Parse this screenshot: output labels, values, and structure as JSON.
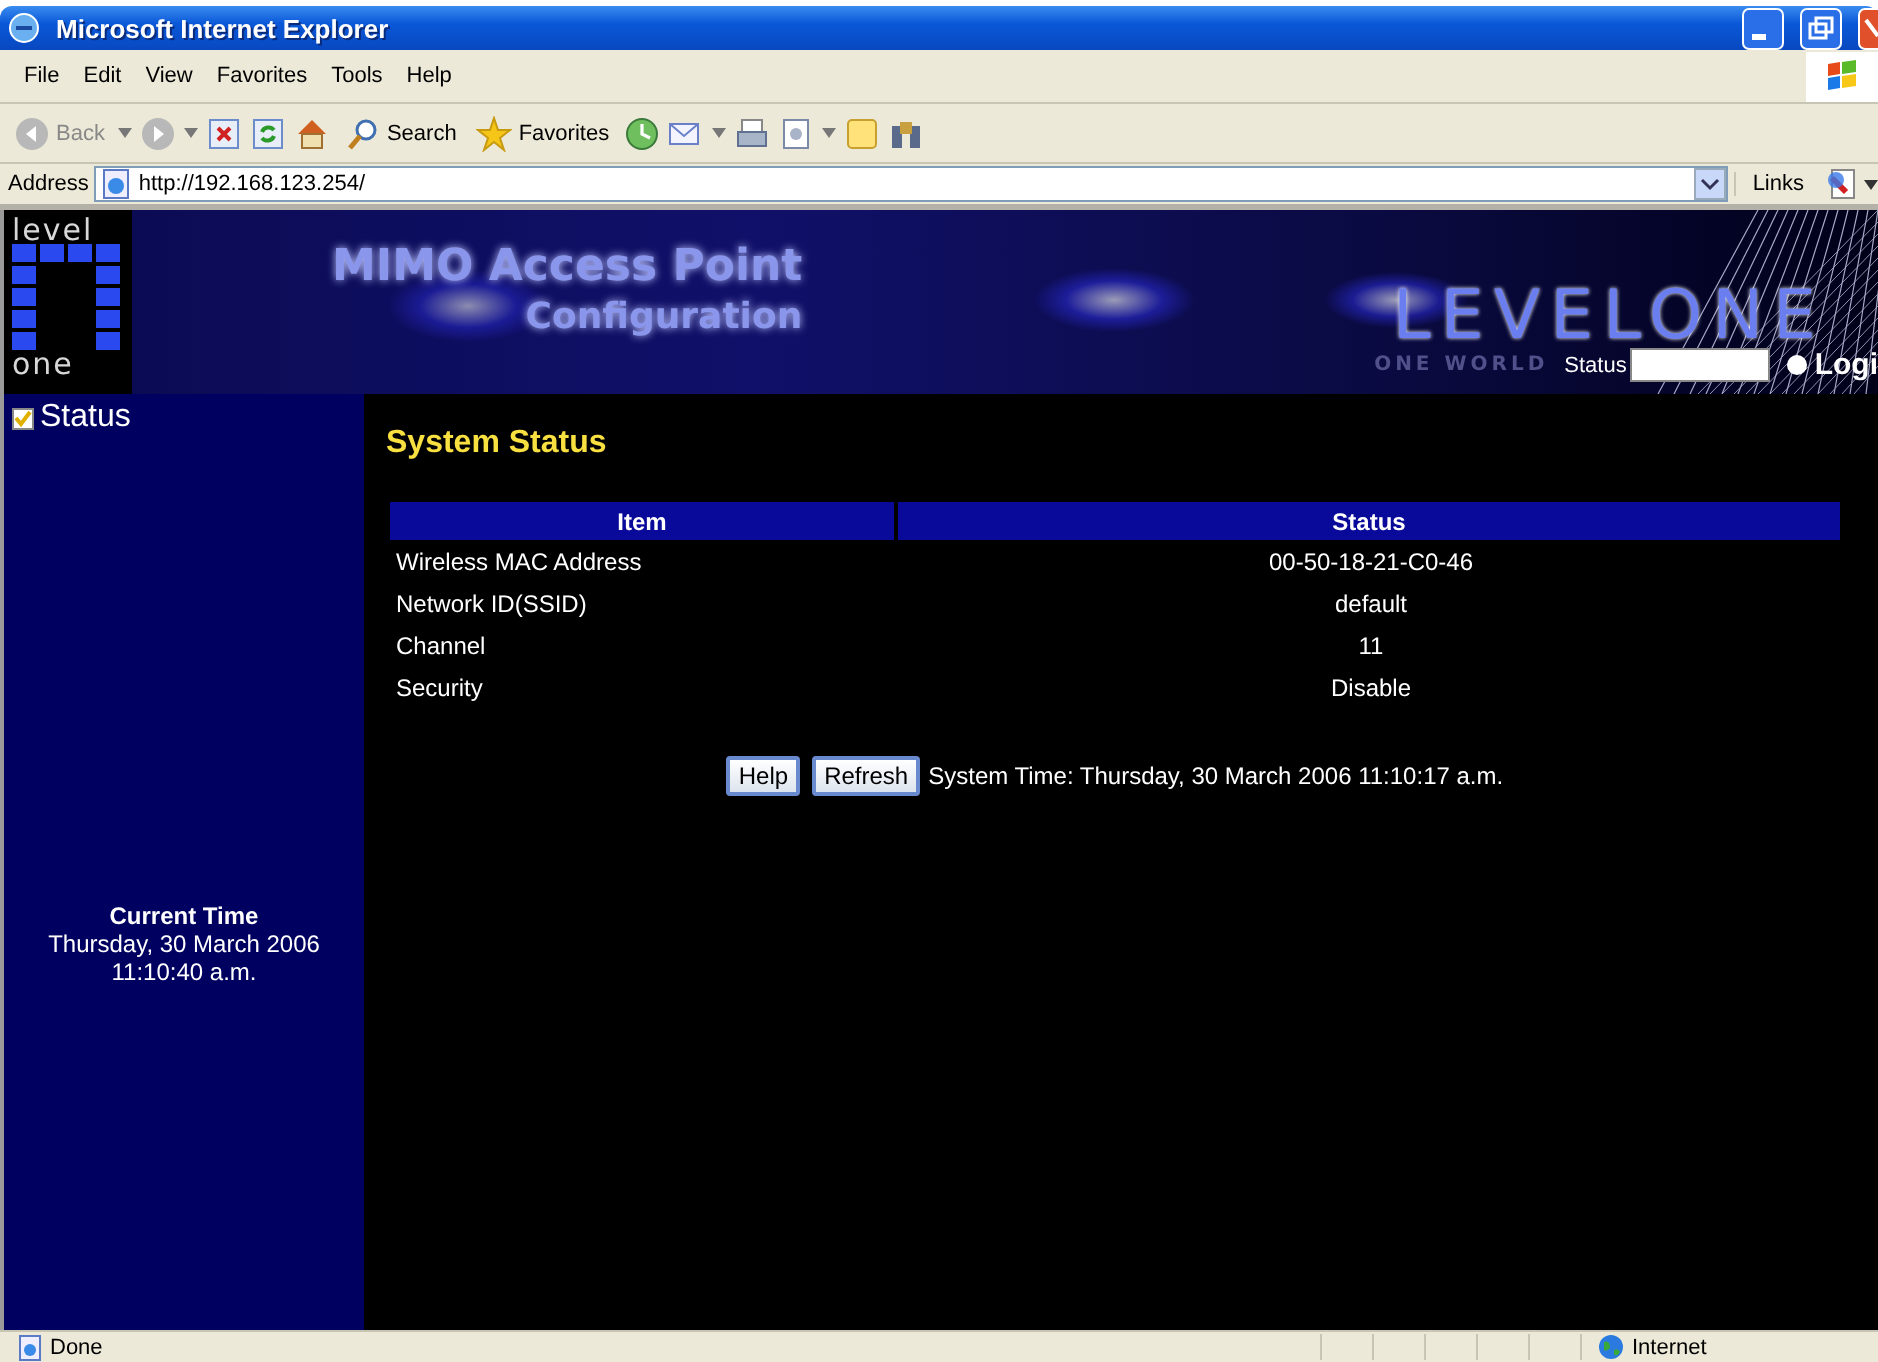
{
  "window": {
    "title": "Microsoft Internet Explorer"
  },
  "menu": [
    "File",
    "Edit",
    "View",
    "Favorites",
    "Tools",
    "Help"
  ],
  "toolbar": [
    {
      "kind": "back",
      "label": "Back"
    },
    {
      "kind": "forward"
    },
    {
      "kind": "stop"
    },
    {
      "kind": "refresh"
    },
    {
      "kind": "home"
    },
    {
      "kind": "search",
      "label": "Search"
    },
    {
      "kind": "favorites",
      "label": "Favorites"
    },
    {
      "kind": "history"
    },
    {
      "kind": "mail"
    },
    {
      "kind": "print"
    },
    {
      "kind": "edit"
    },
    {
      "kind": "note"
    },
    {
      "kind": "research"
    }
  ],
  "address": {
    "label": "Address",
    "url": "http://192.168.123.254/",
    "links": "Links"
  },
  "banner": {
    "logo_top": "level",
    "logo_bottom": "one",
    "title": "MIMO Access Point",
    "subtitle": "Configuration",
    "brand": "LEVELONE",
    "tagline": "ONE WORLD",
    "login": {
      "label": "Status",
      "option": "Logi",
      "selected": true
    }
  },
  "sidebar": {
    "items": [
      {
        "label": "Status",
        "selected": true
      }
    ],
    "clock": {
      "title": "Current Time",
      "date": "Thursday, 30 March 2006",
      "time": "11:10:40 a.m."
    }
  },
  "main": {
    "heading": "System Status",
    "table": {
      "columns": [
        "Item",
        "Status"
      ],
      "rows": [
        [
          "Wireless MAC Address",
          "00-50-18-21-C0-46"
        ],
        [
          "Network ID(SSID)",
          "default"
        ],
        [
          "Channel",
          "11"
        ],
        [
          "Security",
          "Disable"
        ]
      ]
    },
    "buttons": [
      "Help",
      "Refresh"
    ],
    "system_time": "System Time: Thursday, 30 March 2006 11:10:17 a.m."
  },
  "status_bar": {
    "text": "Done",
    "zone": "Internet"
  }
}
